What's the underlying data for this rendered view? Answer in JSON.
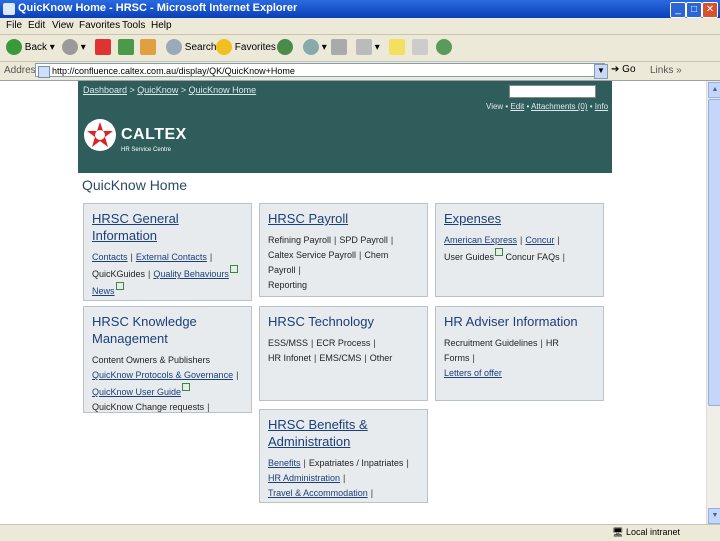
{
  "window": {
    "title": "QuicKnow Home - HRSC - Microsoft Internet Explorer",
    "buttons": {
      "minimize": "_",
      "maximize": "□",
      "close": "✕"
    }
  },
  "menu": [
    "File",
    "Edit",
    "View",
    "Favorites",
    "Tools",
    "Help"
  ],
  "toolbar": {
    "back": "Back",
    "search": "Search",
    "favorites": "Favorites"
  },
  "address": {
    "label": "Address",
    "url": "http://confluence.caltex.com.au/display/QK/QuicKnow+Home",
    "go": "Go",
    "links": "Links"
  },
  "status": {
    "zone": "Local intranet"
  },
  "page": {
    "breadcrumb": [
      "Dashboard",
      "QuicKnow",
      "QuicKnow Home"
    ],
    "breadcrumb_sep": " > ",
    "actions": {
      "view": "View",
      "edit": "Edit",
      "attachments": "Attachments (0)",
      "info": "Info"
    },
    "brand": "CALTEX",
    "brand_sub": "HR Service Centre",
    "title": "QuicKnow Home"
  },
  "cards": {
    "general": {
      "title": "HRSC General Information",
      "links": [
        "Contacts",
        "External Contacts",
        "QuicKGuides",
        "Quality Behaviours",
        "News"
      ]
    },
    "payroll": {
      "title": "HRSC Payroll",
      "links": [
        "Refining Payroll",
        "SPD Payroll",
        "Caltex Service Payroll",
        "Chem Payroll",
        "Reporting"
      ]
    },
    "expenses": {
      "title": "Expenses",
      "links": [
        "American Express",
        "Concur",
        "User Guides",
        "Concur FAQs"
      ]
    },
    "knowledge": {
      "title": "HRSC Knowledge Management",
      "links": [
        "Content Owners & Publishers",
        "QuicKnow Protocols & Governance",
        "QuicKnow User Guide",
        "QuicKnow Change requests"
      ]
    },
    "technology": {
      "title": "HRSC Technology",
      "links": [
        "ESS/MSS",
        "ECR Process",
        "HR Infonet",
        "EMS/CMS",
        "Other"
      ]
    },
    "adviser": {
      "title": "HR Adviser Information",
      "links": [
        "Recruitment Guidelines",
        "HR Forms",
        "Letters of offer"
      ]
    },
    "benefits": {
      "title": "HRSC Benefits & Administration",
      "links": [
        "Benefits",
        "Expatriates / Inpatriates",
        "HR Administration",
        "Travel & Accommodation"
      ]
    }
  }
}
